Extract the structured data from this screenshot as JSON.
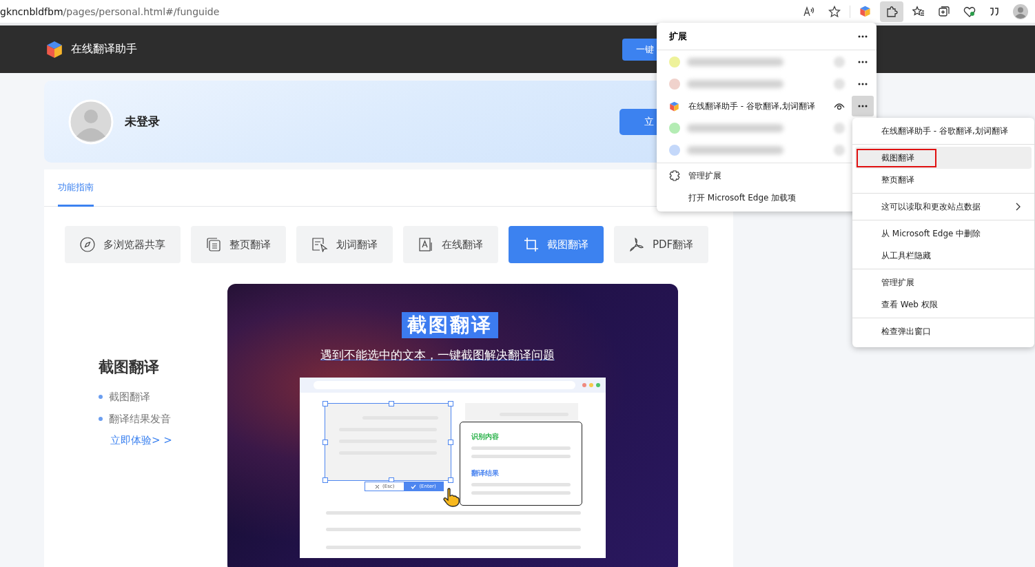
{
  "address_bar": {
    "host": "gkncnbldfbm",
    "path": "/pages/personal.html#/funguide"
  },
  "toolbar": {
    "extensions_selected": true
  },
  "header": {
    "title": "在线翻译助手",
    "button": "一键"
  },
  "profile": {
    "name": "未登录",
    "button": "立"
  },
  "tabs": [
    {
      "label": "功能指南",
      "selected": true
    }
  ],
  "features": [
    {
      "label": "多浏览器共享",
      "kind": "compass",
      "selected": false
    },
    {
      "label": "整页翻译",
      "kind": "pages",
      "selected": false
    },
    {
      "label": "划词翻译",
      "kind": "select",
      "selected": false
    },
    {
      "label": "在线翻译",
      "kind": "letter",
      "selected": false
    },
    {
      "label": "截图翻译",
      "kind": "crop",
      "selected": true
    },
    {
      "label": "PDF翻译",
      "kind": "pdf",
      "selected": false
    }
  ],
  "guide": {
    "title": "截图翻译",
    "bullets": [
      "截图翻译",
      "翻译结果发音"
    ],
    "link": "立即体验> >"
  },
  "illustration": {
    "title": "截图翻译",
    "subtitle": "遇到不能选中的文本，一键截图解决翻译问题",
    "cancel": "(Esc)",
    "confirm": "(Enter)",
    "recognized_label": "识别内容",
    "result_label": "翻译结果"
  },
  "extensions_menu": {
    "title": "扩展",
    "items": [
      {
        "kind": "blurred",
        "color": "#eef29a"
      },
      {
        "kind": "blurred",
        "color": "#f0d2cc"
      },
      {
        "kind": "extension",
        "label": "在线翻译助手 - 谷歌翻译,划词翻译",
        "selected": true
      },
      {
        "kind": "covered",
        "color": "#b4ecb4"
      },
      {
        "kind": "covered",
        "color": "#c4d8fa"
      }
    ],
    "footer": [
      "管理扩展",
      "打开 Microsoft Edge 加载项"
    ]
  },
  "context_menu": {
    "groups": [
      {
        "items": [
          {
            "label": "在线翻译助手 - 谷歌翻译,划词翻译",
            "selected": false,
            "submenu": false
          }
        ]
      },
      {
        "items": [
          {
            "label": "截图翻译",
            "selected": true,
            "submenu": false
          },
          {
            "label": "整页翻译",
            "selected": false,
            "submenu": false
          }
        ]
      },
      {
        "items": [
          {
            "label": "这可以读取和更改站点数据",
            "selected": false,
            "submenu": true
          }
        ]
      },
      {
        "items": [
          {
            "label": "从 Microsoft Edge 中删除",
            "selected": false,
            "submenu": false
          },
          {
            "label": "从工具栏隐藏",
            "selected": false,
            "submenu": false
          }
        ]
      },
      {
        "items": [
          {
            "label": "管理扩展",
            "selected": false,
            "submenu": false
          },
          {
            "label": "查看 Web 权限",
            "selected": false,
            "submenu": false
          }
        ]
      },
      {
        "items": [
          {
            "label": "检查弹出窗口",
            "selected": false,
            "submenu": false
          }
        ]
      }
    ]
  }
}
